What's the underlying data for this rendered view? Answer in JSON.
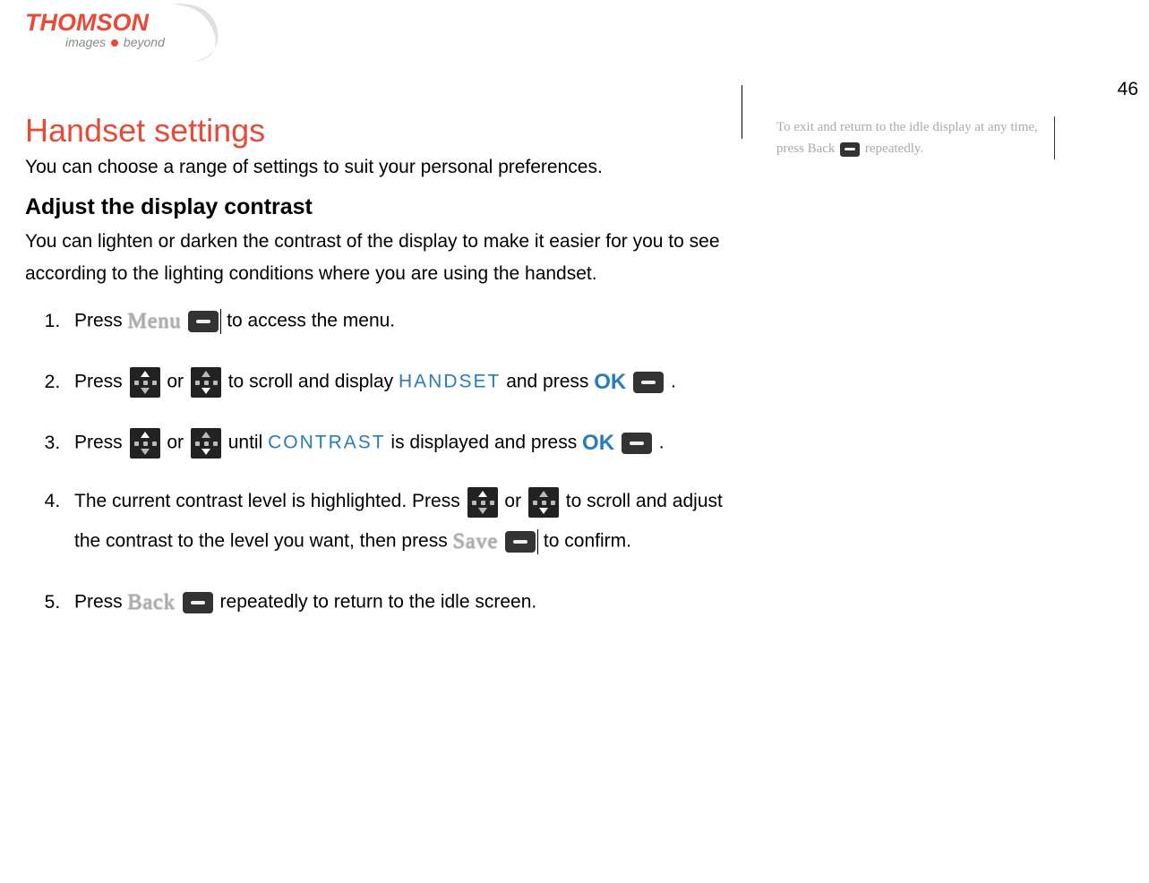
{
  "logo": {
    "brand": "THOMSON",
    "tagline_left": "images",
    "tagline_right": "beyond"
  },
  "page_number": "46",
  "heading": "Handset settings",
  "intro": "You can choose a range of settings to suit your personal preferences.",
  "subheading": "Adjust the display contrast",
  "sub_intro": "You can lighten or darken the contrast of the display to make it easier for you to see according to the lighting conditions where you are using the handset.",
  "steps": {
    "s1": {
      "a": "Press ",
      "menu_label": "Menu",
      "b": "to access the menu."
    },
    "s2": {
      "a": "Press ",
      "b": " or ",
      "c": " to scroll and display ",
      "handset": "HANDSET",
      "d": " and press ",
      "ok": "OK",
      "e": " ."
    },
    "s3": {
      "a": "Press ",
      "b": " or ",
      "c": " until ",
      "contrast": "CONTRAST",
      "d": " is displayed and press ",
      "ok": "OK",
      "e": " ."
    },
    "s4": {
      "a": "The current contrast level is highlighted.  Press ",
      "b": " or ",
      "c": " to scroll and adjust the contrast to the level you want, then press ",
      "save_label": "Save",
      "d": "to confirm."
    },
    "s5": {
      "a": "Press ",
      "back_label": "Back",
      "b": " repeatedly to return to the idle screen."
    }
  },
  "sidebar": {
    "tip_a": "To exit and return to the idle display at any time, press Back ",
    "tip_b": " repeatedly."
  }
}
